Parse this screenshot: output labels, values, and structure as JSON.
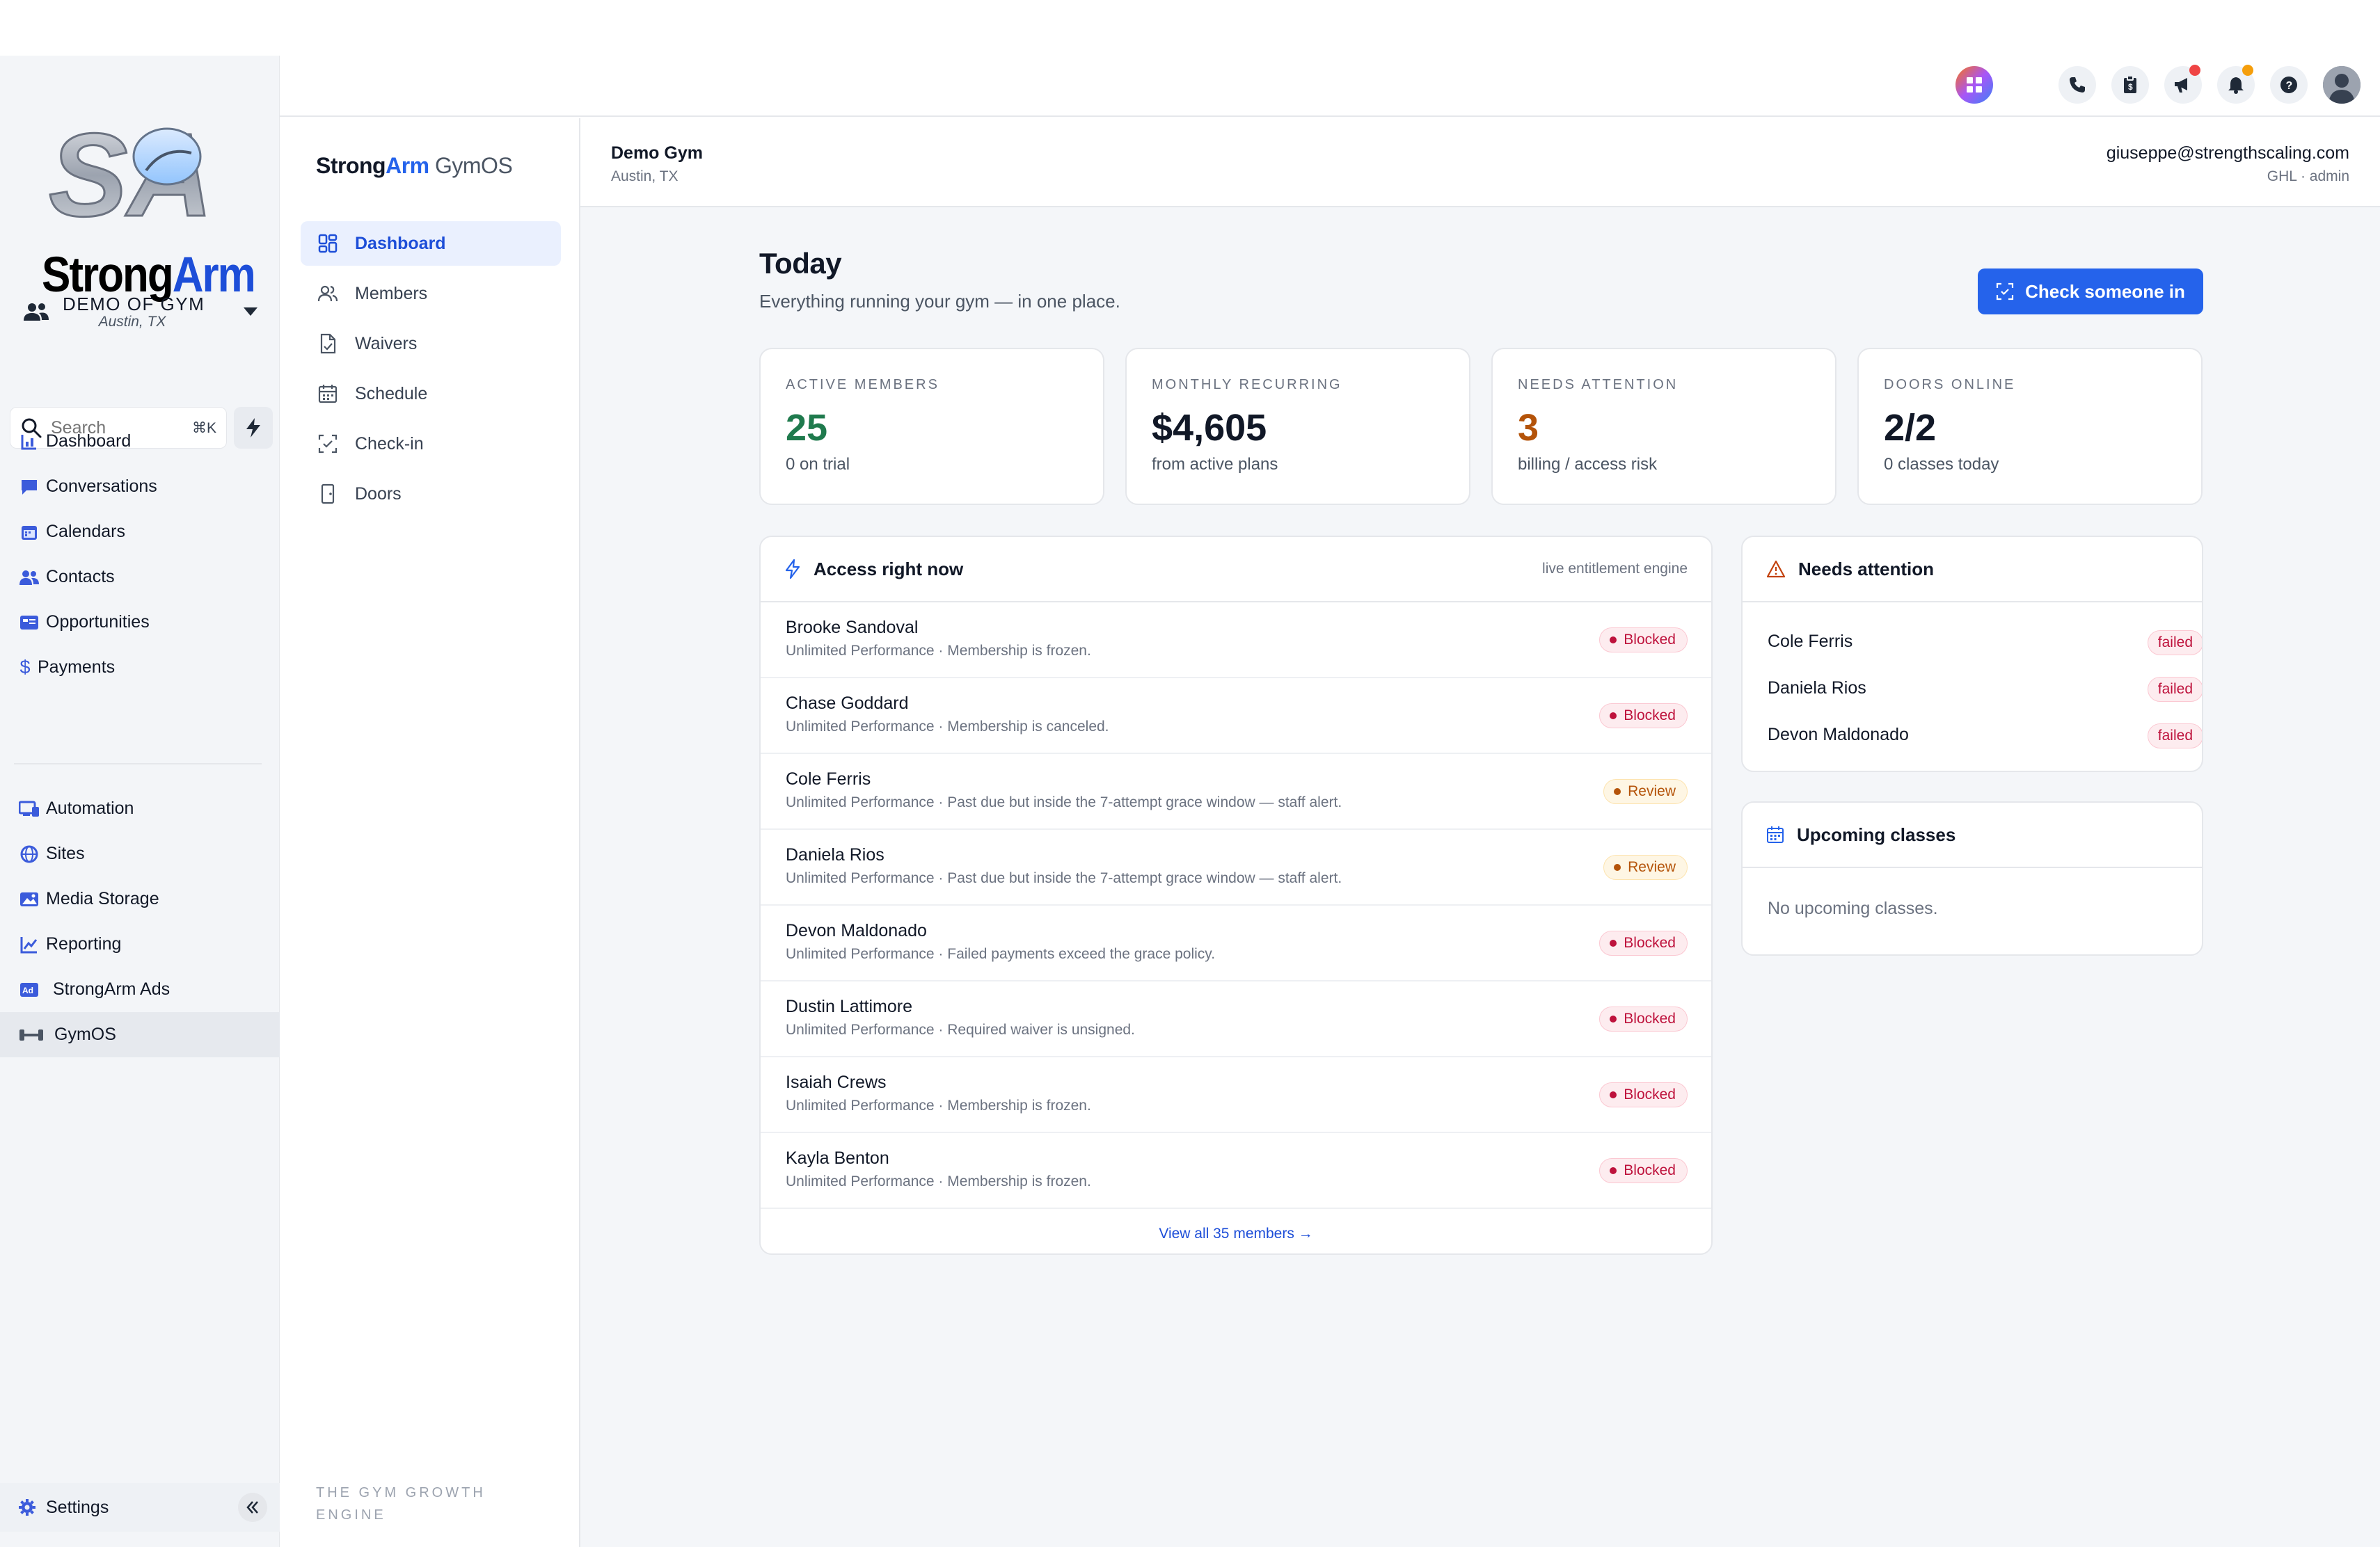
{
  "ghl_sidebar": {
    "logo": {
      "monogram": "SA",
      "word1": "Strong",
      "word2": "Arm"
    },
    "account": {
      "name": "DEMO OF GYM",
      "location": "Austin, TX"
    },
    "search": {
      "placeholder": "Search",
      "shortcut": "⌘K"
    },
    "nav_main": [
      {
        "label": "Dashboard",
        "icon": "dashboard-icon"
      },
      {
        "label": "Conversations",
        "icon": "chat-icon"
      },
      {
        "label": "Calendars",
        "icon": "calendar-icon"
      },
      {
        "label": "Contacts",
        "icon": "contacts-icon"
      },
      {
        "label": "Opportunities",
        "icon": "opportunities-icon"
      },
      {
        "label": "Payments",
        "icon": "dollar-icon"
      }
    ],
    "nav_secondary": [
      {
        "label": "Automation",
        "icon": "automation-icon"
      },
      {
        "label": "Sites",
        "icon": "globe-icon"
      },
      {
        "label": "Media Storage",
        "icon": "image-icon"
      },
      {
        "label": "Reporting",
        "icon": "chart-line-icon"
      },
      {
        "label": "StrongArm Ads",
        "icon": "ads-icon"
      },
      {
        "label": "GymOS",
        "icon": "dumbbell-icon",
        "active": true
      }
    ],
    "settings_label": "Settings"
  },
  "topbar": {
    "icons": [
      "apps-icon",
      "phone-icon",
      "clipboard-icon",
      "megaphone-icon",
      "bell-icon",
      "help-icon",
      "avatar"
    ],
    "status_colors": {
      "megaphone": "#ef4444",
      "bell": "#f59e0b"
    }
  },
  "gym_sidebar": {
    "brand": {
      "part1": "Strong",
      "part2": "Arm",
      "part3": " GymOS"
    },
    "nav": [
      {
        "label": "Dashboard",
        "icon": "grid-icon",
        "active": true
      },
      {
        "label": "Members",
        "icon": "members-icon"
      },
      {
        "label": "Waivers",
        "icon": "document-icon"
      },
      {
        "label": "Schedule",
        "icon": "calendar-icon"
      },
      {
        "label": "Check-in",
        "icon": "scan-check-icon"
      },
      {
        "label": "Doors",
        "icon": "door-icon"
      }
    ],
    "tagline": "THE GYM GROWTH ENGINE"
  },
  "header": {
    "gym_name": "Demo Gym",
    "gym_location": "Austin, TX",
    "user_email": "giuseppe@strengthscaling.com",
    "user_role": "GHL · admin"
  },
  "today": {
    "title": "Today",
    "subtitle": "Everything running your gym — in one place.",
    "checkin_button": "Check someone in"
  },
  "stats": [
    {
      "label": "ACTIVE MEMBERS",
      "value": "25",
      "sub": "0 on trial",
      "color": "#1f7a4d"
    },
    {
      "label": "MONTHLY RECURRING",
      "value": "$4,605",
      "sub": "from active plans",
      "color": "#111827"
    },
    {
      "label": "NEEDS ATTENTION",
      "value": "3",
      "sub": "billing / access risk",
      "color": "#b45309"
    },
    {
      "label": "DOORS ONLINE",
      "value": "2/2",
      "sub": "0 classes today",
      "color": "#111827"
    }
  ],
  "access": {
    "title": "Access right now",
    "meta": "live entitlement engine",
    "rows": [
      {
        "name": "Brooke Sandoval",
        "detail": "Unlimited Performance · Membership is frozen.",
        "status": "Blocked"
      },
      {
        "name": "Chase Goddard",
        "detail": "Unlimited Performance · Membership is canceled.",
        "status": "Blocked"
      },
      {
        "name": "Cole Ferris",
        "detail": "Unlimited Performance · Past due but inside the 7-attempt grace window — staff alert.",
        "status": "Review"
      },
      {
        "name": "Daniela Rios",
        "detail": "Unlimited Performance · Past due but inside the 7-attempt grace window — staff alert.",
        "status": "Review"
      },
      {
        "name": "Devon Maldonado",
        "detail": "Unlimited Performance · Failed payments exceed the grace policy.",
        "status": "Blocked"
      },
      {
        "name": "Dustin Lattimore",
        "detail": "Unlimited Performance · Required waiver is unsigned.",
        "status": "Blocked"
      },
      {
        "name": "Isaiah Crews",
        "detail": "Unlimited Performance · Membership is frozen.",
        "status": "Blocked"
      },
      {
        "name": "Kayla Benton",
        "detail": "Unlimited Performance · Membership is frozen.",
        "status": "Blocked"
      }
    ],
    "view_all": "View all 35 members →"
  },
  "needs_attention": {
    "title": "Needs attention",
    "rows": [
      {
        "name": "Cole Ferris",
        "status": "failed"
      },
      {
        "name": "Daniela Rios",
        "status": "failed"
      },
      {
        "name": "Devon Maldonado",
        "status": "failed"
      }
    ]
  },
  "upcoming": {
    "title": "Upcoming classes",
    "empty": "No upcoming classes."
  },
  "colors": {
    "accent": "#2563eb",
    "blocked": "#be123c",
    "review": "#b45309"
  }
}
